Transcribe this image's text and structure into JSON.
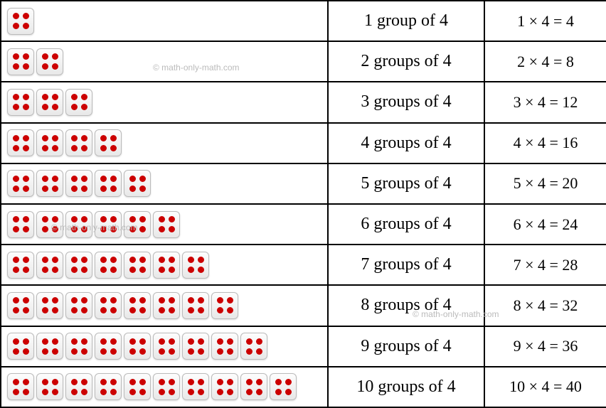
{
  "chart_data": {
    "type": "table",
    "title": "Multiplication table of 4 (groups of 4)",
    "rows": [
      {
        "groups": 1,
        "desc": "1 group of   4",
        "equation": "1 × 4 = 4"
      },
      {
        "groups": 2,
        "desc": "2 groups of  4",
        "equation": "2 × 4 = 8"
      },
      {
        "groups": 3,
        "desc": "3 groups of 4",
        "equation": "3 × 4 = 12"
      },
      {
        "groups": 4,
        "desc": "4 groups of  4",
        "equation": "4 × 4 = 16"
      },
      {
        "groups": 5,
        "desc": "5 groups of 4",
        "equation": "5 × 4 = 20"
      },
      {
        "groups": 6,
        "desc": "6 groups of 4",
        "equation": "6 × 4 = 24"
      },
      {
        "groups": 7,
        "desc": "7 groups of  4",
        "equation": "7 × 4 = 28"
      },
      {
        "groups": 8,
        "desc": "8 groups of 4",
        "equation": "8 × 4 = 32"
      },
      {
        "groups": 9,
        "desc": "9 groups of 4",
        "equation": "9 × 4 = 36"
      },
      {
        "groups": 10,
        "desc": "10 groups of 4",
        "equation": "10 × 4 = 40"
      }
    ]
  },
  "watermark": "© math-only-math.com"
}
